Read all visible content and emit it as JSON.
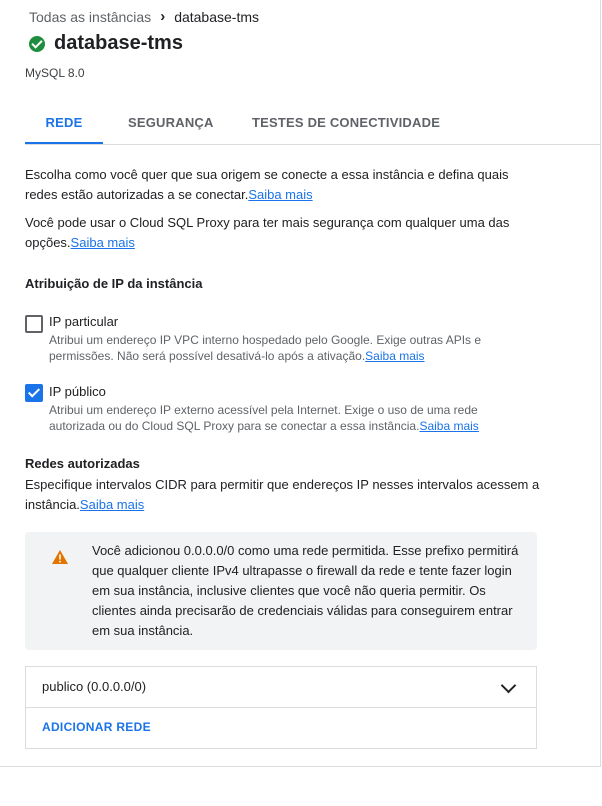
{
  "breadcrumb": {
    "parent": "Todas as instâncias",
    "separator": "›",
    "current": "database-tms"
  },
  "header": {
    "title": "database-tms",
    "subtitle": "MySQL 8.0"
  },
  "tabs": [
    {
      "label": "REDE",
      "active": true
    },
    {
      "label": "SEGURANÇA",
      "active": false
    },
    {
      "label": "TESTES DE CONECTIVIDADE",
      "active": false
    }
  ],
  "intro": {
    "text": "Escolha como você quer que sua origem se conecte a essa instância e defina quais redes estão autorizadas a se conectar.",
    "link": "Saiba mais"
  },
  "proxy": {
    "text": "Você pode usar o Cloud SQL Proxy para ter mais segurança com qualquer uma das opções.",
    "link": "Saiba mais"
  },
  "ip_assignment": {
    "title": "Atribuição de IP da instância",
    "private": {
      "label": "IP particular",
      "checked": false,
      "desc": "Atribui um endereço IP VPC interno hospedado pelo Google. Exige outras APIs e permissões. Não será possível desativá-lo após a ativação.",
      "link": "Saiba mais"
    },
    "public": {
      "label": "IP público",
      "checked": true,
      "desc": "Atribui um endereço IP externo acessível pela Internet. Exige o uso de uma rede autorizada ou do Cloud SQL Proxy para se conectar a essa instância.",
      "link": "Saiba mais"
    }
  },
  "authorized": {
    "title": "Redes autorizadas",
    "text": "Especifique intervalos CIDR para permitir que endereços IP nesses intervalos acessem a instância.",
    "link": "Saiba mais"
  },
  "alert": {
    "icon": "warning-icon",
    "text": "Você adicionou 0.0.0.0/0 como uma rede permitida. Esse prefixo permitirá que qualquer cliente IPv4 ultrapasse o firewall da rede e tente fazer login em sua instância, inclusive clientes que você não queria permitir. Os clientes ainda precisarão de credenciais válidas para conseguirem entrar em sua instância."
  },
  "networks": {
    "items": [
      {
        "label": "publico (0.0.0.0/0)"
      }
    ],
    "add_label": "ADICIONAR REDE"
  },
  "colors": {
    "accent": "#1a73e8",
    "success": "#1e8e3e",
    "warning": "#e37400",
    "alert_bg": "#f1f3f4"
  }
}
